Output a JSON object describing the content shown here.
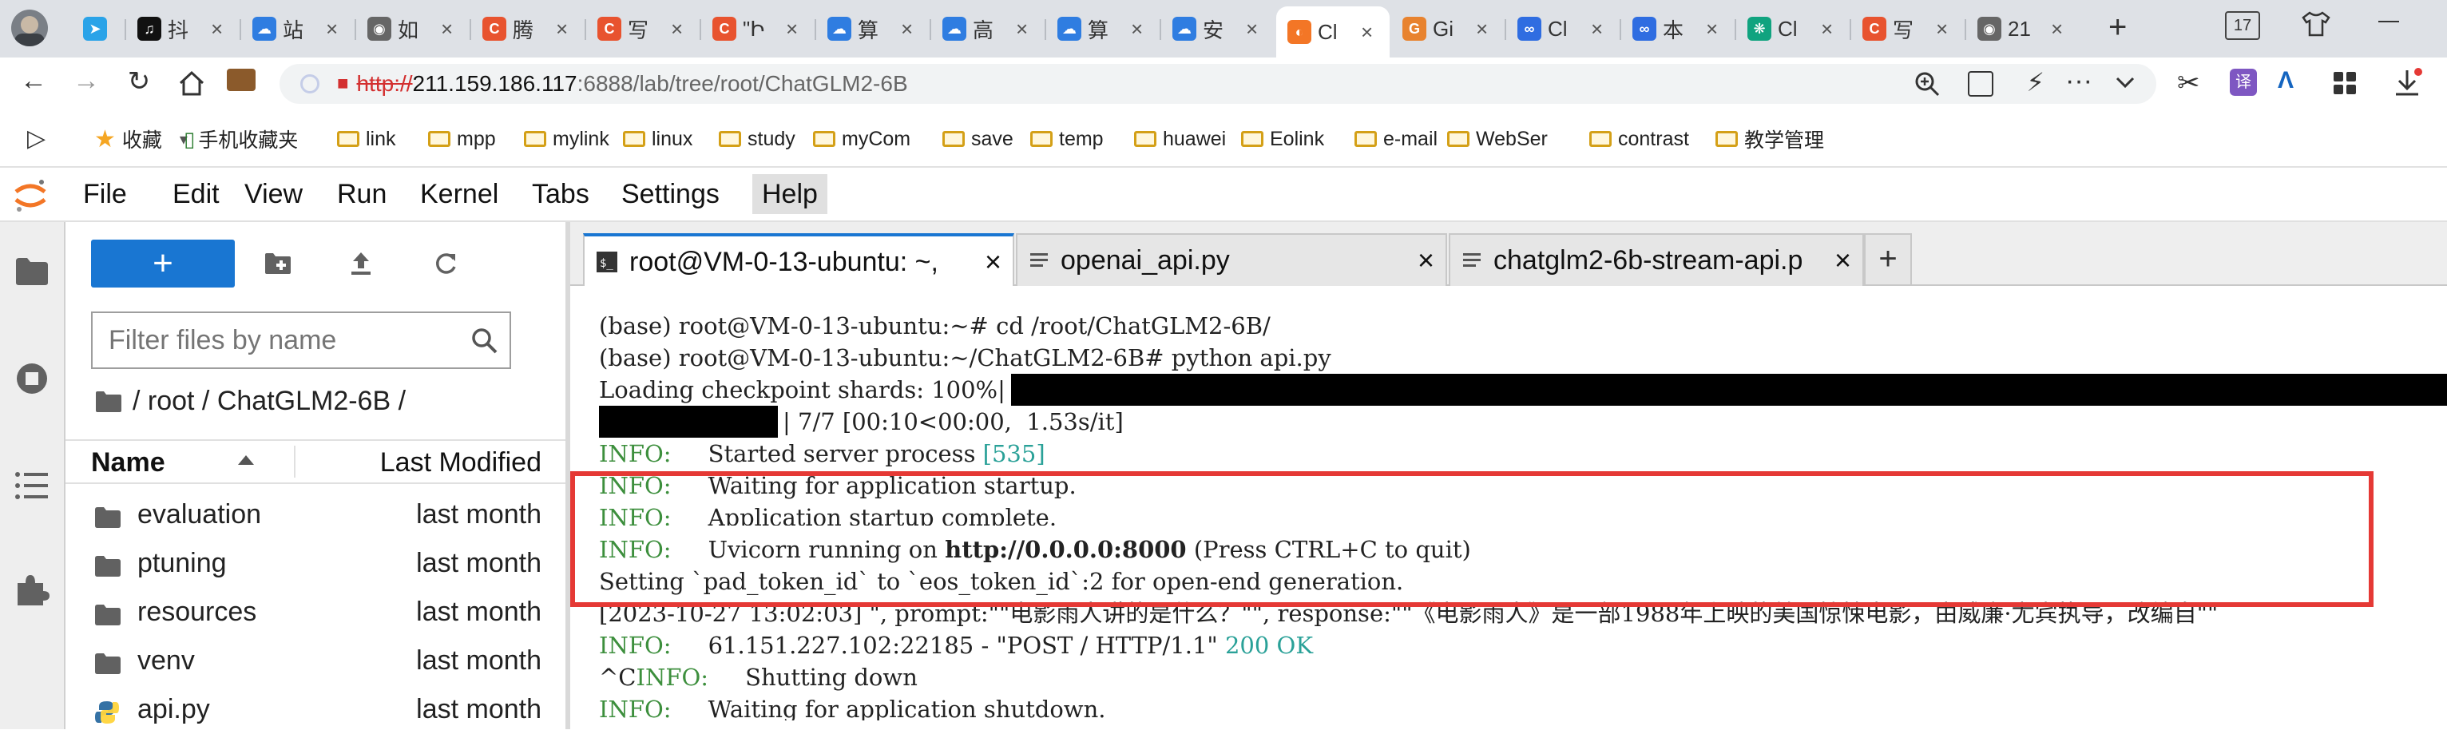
{
  "browser_tabs": [
    {
      "label": "",
      "icon": "telegram-icon",
      "color": "#2aa3e8"
    },
    {
      "label": "抖",
      "icon": "tiktok-icon",
      "color": "#111111"
    },
    {
      "label": "站",
      "icon": "cloud-icon",
      "color": "#2f7de1"
    },
    {
      "label": "如",
      "icon": "globe-icon",
      "color": "#666666"
    },
    {
      "label": "腾",
      "icon": "csdn-icon",
      "color": "#e8532f"
    },
    {
      "label": "写",
      "icon": "csdn-icon",
      "color": "#e8532f"
    },
    {
      "label": "\"Ի",
      "icon": "csdn-icon",
      "color": "#e8532f"
    },
    {
      "label": "算",
      "icon": "cloud-icon",
      "color": "#2f7de1"
    },
    {
      "label": "高",
      "icon": "cloud-icon",
      "color": "#2f7de1"
    },
    {
      "label": "算",
      "icon": "cloud-icon",
      "color": "#2f7de1"
    },
    {
      "label": "安",
      "icon": "cloud-icon",
      "color": "#2f7de1"
    },
    {
      "label": "Cl",
      "icon": "jupyter-icon",
      "color": "#f37626"
    },
    {
      "label": "Gi",
      "icon": "gitee-icon",
      "color": "#e8832f"
    },
    {
      "label": "Cl",
      "icon": "meta-icon",
      "color": "#2f6de1"
    },
    {
      "label": "本",
      "icon": "meta-icon",
      "color": "#2f6de1"
    },
    {
      "label": "Cl",
      "icon": "openai-icon",
      "color": "#10a37f"
    },
    {
      "label": "写",
      "icon": "csdn-icon",
      "color": "#e8532f"
    },
    {
      "label": "21",
      "icon": "globe-icon",
      "color": "#666666"
    }
  ],
  "browser": {
    "new_tab": "+",
    "tab_count": "17",
    "url_protocol": "http://",
    "url_host": "211.159.186.117",
    "url_path": ":6888/lab/tree/root/ChatGLM2-6B",
    "extension_label": "译"
  },
  "bookmarks": [
    {
      "label": "收藏",
      "kind": "star"
    },
    {
      "label": "手机收藏夹",
      "kind": "phone"
    },
    {
      "label": "link",
      "kind": "folder"
    },
    {
      "label": "mpp",
      "kind": "folder"
    },
    {
      "label": "mylink",
      "kind": "folder"
    },
    {
      "label": "linux",
      "kind": "folder"
    },
    {
      "label": "study",
      "kind": "folder"
    },
    {
      "label": "myCom",
      "kind": "folder"
    },
    {
      "label": "save",
      "kind": "folder"
    },
    {
      "label": "temp",
      "kind": "folder"
    },
    {
      "label": "huawei",
      "kind": "folder"
    },
    {
      "label": "Eolink",
      "kind": "folder"
    },
    {
      "label": "e-mail",
      "kind": "folder"
    },
    {
      "label": "WebSer",
      "kind": "folder"
    },
    {
      "label": "contrast",
      "kind": "folder"
    },
    {
      "label": "教学管理",
      "kind": "folder"
    }
  ],
  "menu": [
    "File",
    "Edit",
    "View",
    "Run",
    "Kernel",
    "Tabs",
    "Settings",
    "Help"
  ],
  "filebrowser": {
    "new_label": "+",
    "filter_placeholder": "Filter files by name",
    "breadcrumb": "/ root / ChatGLM2-6B /",
    "col_name": "Name",
    "col_modified": "Last Modified",
    "files": [
      {
        "name": "evaluation",
        "modified": "last month",
        "type": "folder"
      },
      {
        "name": "ptuning",
        "modified": "last month",
        "type": "folder"
      },
      {
        "name": "resources",
        "modified": "last month",
        "type": "folder"
      },
      {
        "name": "venv",
        "modified": "last month",
        "type": "folder"
      },
      {
        "name": "api.py",
        "modified": "last month",
        "type": "python"
      }
    ]
  },
  "dock_tabs": [
    {
      "label": "root@VM-0-13-ubuntu: ~,",
      "icon": "terminal-icon"
    },
    {
      "label": "openai_api.py",
      "icon": "text-file-icon"
    },
    {
      "label": "chatglm2-6b-stream-api.p",
      "icon": "text-file-icon"
    }
  ],
  "dock_add": "+",
  "terminal": {
    "l1": "(base) root@VM-0-13-ubuntu:~# cd /root/ChatGLM2-6B/",
    "l2": "(base) root@VM-0-13-ubuntu:~/ChatGLM2-6B# python api.py",
    "l3": "Loading checkpoint shards: 100%|",
    "l4": "| 7/7 [00:10<00:00,  1.53s/it]",
    "info": "INFO:",
    "l5_text": "     Started server process ",
    "l5_pid": "[535]",
    "l6_text": "     Waiting for application startup.",
    "l7_text": "     Application startup complete.",
    "l8_text": "     Uvicorn running on ",
    "l8_url": "http://0.0.0.0:8000",
    "l8_tail": " (Press CTRL+C to quit)",
    "l9": "Setting `pad_token_id` to `eos_token_id`:2 for open-end generation.",
    "l10": "[2023-10-27 13:02:03] \", prompt:\"\"电影雨人讲的是什么？\"\", response:\"\"《电影雨人》是一部1988年上映的美国惊悚电影，由威廉·尤宾执导，改编自\"\"",
    "l11_text": "     61.151.227.102:22185 - \"POST / HTTP/1.1\" ",
    "l11_status": "200 OK",
    "l12_prefix": "^C",
    "l12_text": "     Shutting down",
    "l13_text": "     Waiting for application shutdown."
  }
}
